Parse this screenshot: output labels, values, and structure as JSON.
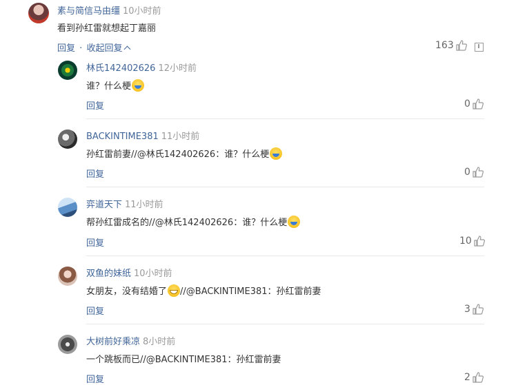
{
  "main_comment": {
    "username": "素与简信马由缰",
    "time": "10小时前",
    "text": "看到孙红雷就想起丁嘉丽",
    "reply_label": "回复",
    "separator": "·",
    "collapse_label": "收起回复",
    "likes": "163"
  },
  "replies": [
    {
      "username": "林氏142402626",
      "time": "12小时前",
      "text": "谁？什么梗",
      "reply_label": "回复",
      "likes": "0"
    },
    {
      "username": "BACKINTIME381",
      "time": "11小时前",
      "text": "孙红雷前妻//@林氏142402626：谁？什么梗",
      "reply_label": "回复",
      "likes": "0"
    },
    {
      "username": "弈道天下",
      "time": "11小时前",
      "text": "帮孙红雷成名的//@林氏142402626：谁？什么梗",
      "reply_label": "回复",
      "likes": "10"
    },
    {
      "username": "双鱼的妹纸",
      "time": "10小时前",
      "text_before": "女朋友，没有结婚了",
      "text_after": "//@BACKINTIME381：孙红雷前妻",
      "reply_label": "回复",
      "likes": "3"
    },
    {
      "username": "大树前好乘凉",
      "time": "8小时前",
      "text": "一个跳板而已//@BACKINTIME381：孙红雷前妻",
      "reply_label": "回复",
      "likes": "2"
    }
  ],
  "icons": {
    "like": "thumbs-up-icon",
    "report": "report-icon",
    "laugh_emoji": "laugh-cry-emoji",
    "grin_emoji": "grin-emoji"
  },
  "colors": {
    "username": "#406599",
    "time": "#999999",
    "link": "#406599",
    "text": "#333333"
  }
}
